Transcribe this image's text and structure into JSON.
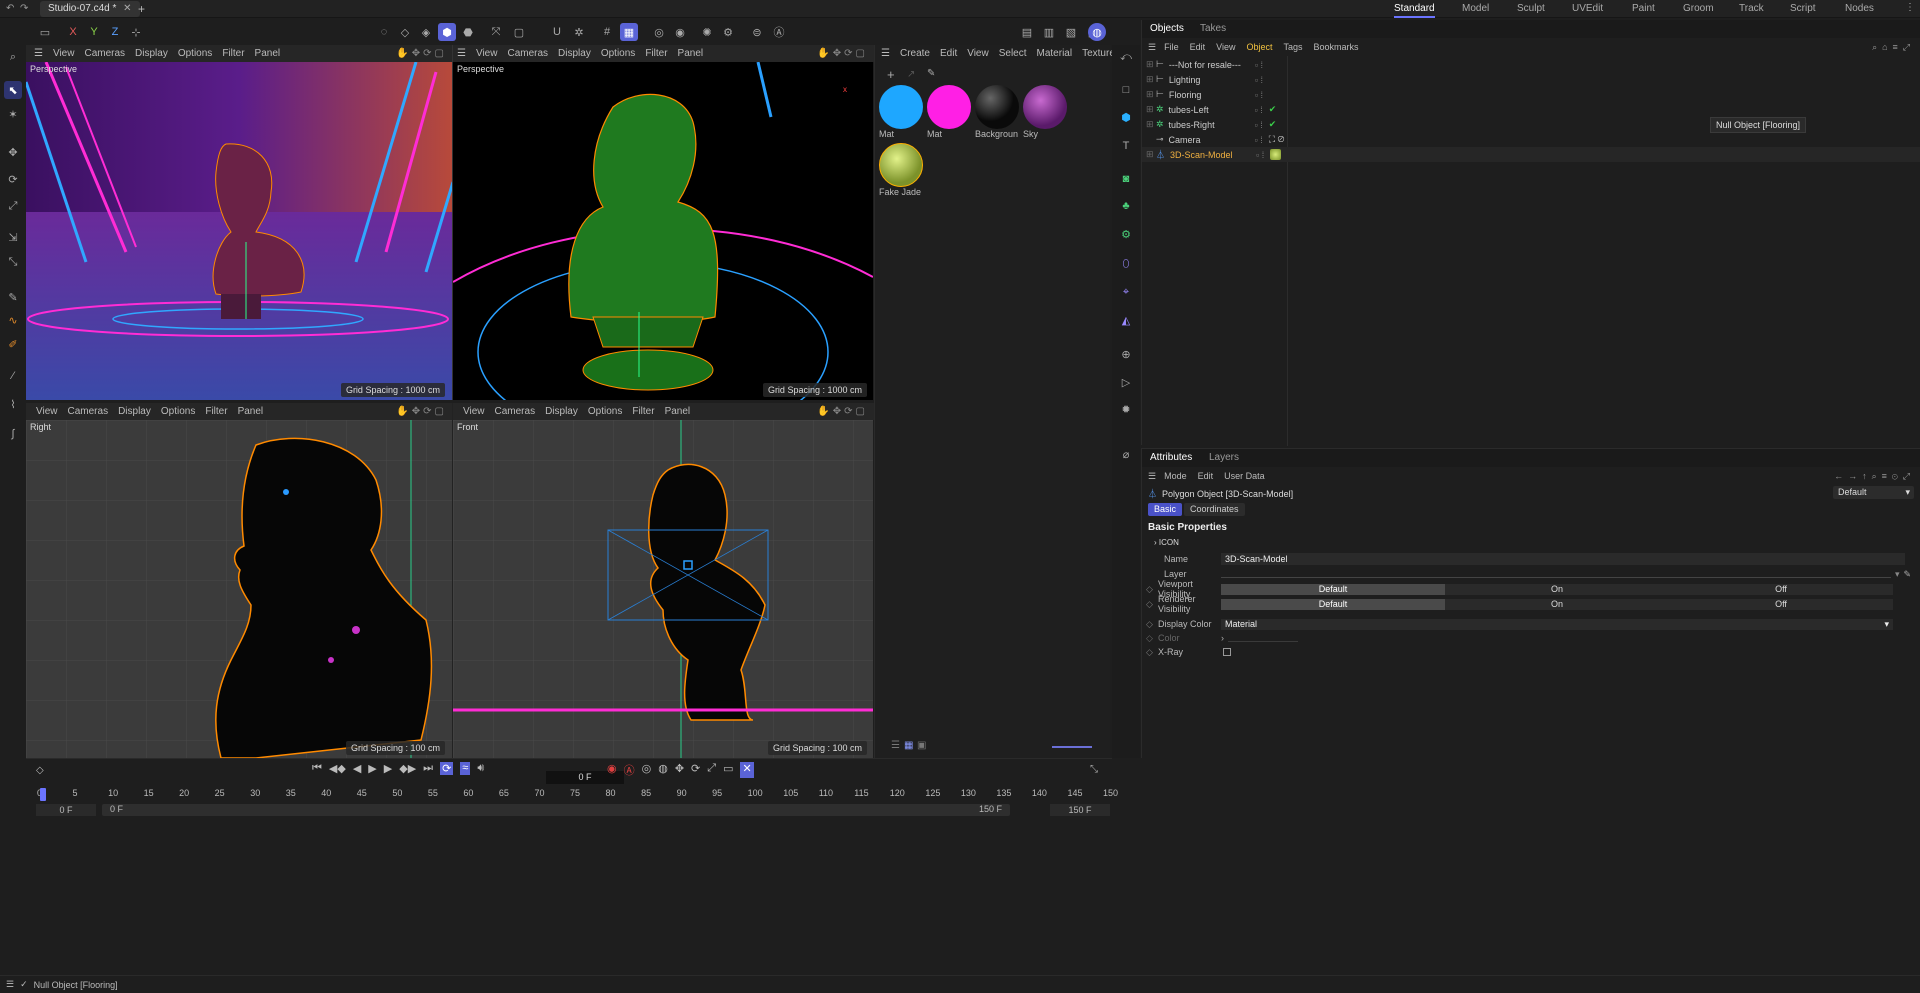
{
  "app": {
    "document_tab": "Studio-07.c4d *",
    "workspaces": [
      "Standard",
      "Model",
      "Sculpt",
      "UVEdit",
      "Paint",
      "Groom",
      "Track",
      "Script",
      "Nodes"
    ],
    "active_workspace": "Standard"
  },
  "viewports": [
    {
      "id": "tl",
      "menus": [
        "View",
        "Cameras",
        "Display",
        "Options",
        "Filter",
        "Panel"
      ],
      "label": "Perspective",
      "grid": "Grid Spacing : 1000 cm"
    },
    {
      "id": "tr",
      "menus": [
        "View",
        "Cameras",
        "Display",
        "Options",
        "Filter",
        "Panel"
      ],
      "label": "Perspective",
      "grid": "Grid Spacing : 1000 cm"
    },
    {
      "id": "bl",
      "menus": [
        "View",
        "Cameras",
        "Display",
        "Options",
        "Filter",
        "Panel"
      ],
      "label": "Right",
      "grid": "Grid Spacing : 100 cm"
    },
    {
      "id": "br",
      "menus": [
        "View",
        "Cameras",
        "Display",
        "Options",
        "Filter",
        "Panel"
      ],
      "label": "Front",
      "grid": "Grid Spacing : 100 cm"
    }
  ],
  "material_manager": {
    "menus": [
      "Create",
      "Edit",
      "View",
      "Select",
      "Material",
      "Texture"
    ],
    "materials": [
      {
        "name": "Mat",
        "color": "#1ea7ff"
      },
      {
        "name": "Mat",
        "color": "#ff1fe5"
      },
      {
        "name": "Backgroun",
        "color": "#0a0a0a"
      },
      {
        "name": "Sky",
        "color": "#7a2a86"
      },
      {
        "name": "Fake Jade",
        "color": "#a9c23e"
      }
    ]
  },
  "timeline": {
    "frame_field": "0 F",
    "ticks": [
      "0",
      "5",
      "10",
      "15",
      "20",
      "25",
      "30",
      "35",
      "40",
      "45",
      "50",
      "55",
      "60",
      "65",
      "70",
      "75",
      "80",
      "85",
      "90",
      "95",
      "100",
      "105",
      "110",
      "115",
      "120",
      "125",
      "130",
      "135",
      "140",
      "145",
      "150"
    ],
    "start": "0 F",
    "range_start": "0 F",
    "range_end": "150 F",
    "end": "150 F"
  },
  "objects_panel": {
    "tabs": [
      "Objects",
      "Takes"
    ],
    "menus": [
      "File",
      "Edit",
      "View",
      "Object",
      "Tags",
      "Bookmarks"
    ],
    "active_menu": "Object",
    "items": [
      {
        "name": "---Not for resale---",
        "tag": ""
      },
      {
        "name": "Lighting",
        "tag": ""
      },
      {
        "name": "Flooring",
        "tag": ""
      },
      {
        "name": "tubes-Left",
        "tag": "check"
      },
      {
        "name": "tubes-Right",
        "tag": "check"
      },
      {
        "name": "Camera",
        "tag": "camera"
      },
      {
        "name": "3D-Scan-Model",
        "tag": "material"
      }
    ],
    "tooltip": "Null Object [Flooring]"
  },
  "attributes_panel": {
    "tabs": [
      "Attributes",
      "Layers"
    ],
    "menus": [
      "Mode",
      "Edit",
      "User Data"
    ],
    "object_title": "Polygon Object [3D-Scan-Model]",
    "preset": "Default",
    "subtabs": [
      "Basic",
      "Coordinates"
    ],
    "section": "Basic Properties",
    "icon_group": "ICON",
    "name_label": "Name",
    "name_value": "3D-Scan-Model",
    "layer_label": "Layer",
    "viewport_visibility_label": "Viewport Visibility",
    "renderer_visibility_label": "Renderer Visibility",
    "visibility_options": [
      "Default",
      "On",
      "Off"
    ],
    "display_color_label": "Display Color",
    "display_color_value": "Material",
    "color_label": "Color",
    "xray_label": "X-Ray"
  },
  "status_bar": {
    "text": "Null Object [Flooring]"
  }
}
